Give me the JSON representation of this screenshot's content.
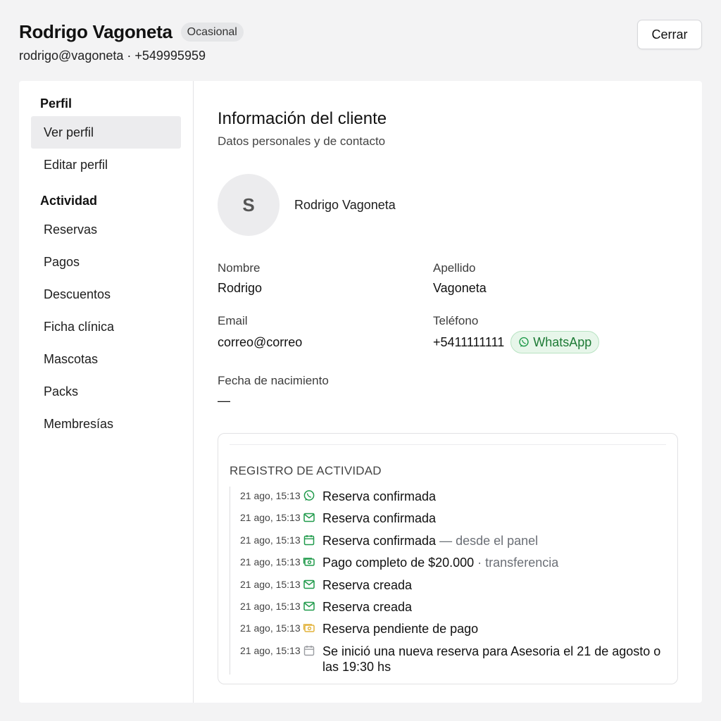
{
  "header": {
    "client_name": "Rodrigo Vagoneta",
    "badge": "Ocasional",
    "subtitle": "rodrigo@vagoneta · +549995959",
    "close_label": "Cerrar"
  },
  "sidebar": {
    "sections": [
      {
        "title": "Perfil",
        "items": [
          "Ver perfil",
          "Editar perfil"
        ]
      },
      {
        "title": "Actividad",
        "items": [
          "Reservas",
          "Pagos",
          "Descuentos",
          "Ficha clínica",
          "Mascotas",
          "Packs",
          "Membresías"
        ]
      }
    ],
    "active_item": "Ver perfil"
  },
  "info": {
    "title": "Información del cliente",
    "subtitle": "Datos personales y de contacto",
    "avatar_initial": "S",
    "avatar_name": "Rodrigo Vagoneta",
    "fields": {
      "nombre": {
        "label": "Nombre",
        "value": "Rodrigo"
      },
      "apellido": {
        "label": "Apellido",
        "value": "Vagoneta"
      },
      "email": {
        "label": "Email",
        "value": "correo@correo"
      },
      "telefono": {
        "label": "Teléfono",
        "value": "+5411111111",
        "whatsapp_label": "WhatsApp"
      },
      "nacimiento": {
        "label": "Fecha de nacimiento",
        "value": "—"
      }
    }
  },
  "activity_log": {
    "title": "REGISTRO DE ACTIVIDAD",
    "entries": [
      {
        "time": "21 ago, 15:13",
        "icon": "whatsapp-icon",
        "text": "Reserva confirmada",
        "detail": ""
      },
      {
        "time": "21 ago, 15:13",
        "icon": "mail-icon",
        "text": "Reserva confirmada",
        "detail": ""
      },
      {
        "time": "21 ago, 15:13",
        "icon": "calendar-icon",
        "text": "Reserva confirmada",
        "detail": " — desde el panel"
      },
      {
        "time": "21 ago, 15:13",
        "icon": "money-icon",
        "text": "Pago completo de $20.000",
        "detail": " · transferencia"
      },
      {
        "time": "21 ago, 15:13",
        "icon": "mail-icon",
        "text": "Reserva creada",
        "detail": ""
      },
      {
        "time": "21 ago, 15:13",
        "icon": "mail-icon",
        "text": "Reserva creada",
        "detail": ""
      },
      {
        "time": "21 ago, 15:13",
        "icon": "pending-money-icon",
        "text": "Reserva pendiente de pago",
        "detail": ""
      },
      {
        "time": "21 ago, 15:13",
        "icon": "calendar-gray-icon",
        "text": "Se inició una nueva reserva para Asesoria el 21 de agosto o las 19:30 hs",
        "detail": ""
      }
    ]
  },
  "colors": {
    "accent_green": "#1f9a4a",
    "pending_yellow": "#e2b23a",
    "muted_gray": "#9a9ca1"
  }
}
